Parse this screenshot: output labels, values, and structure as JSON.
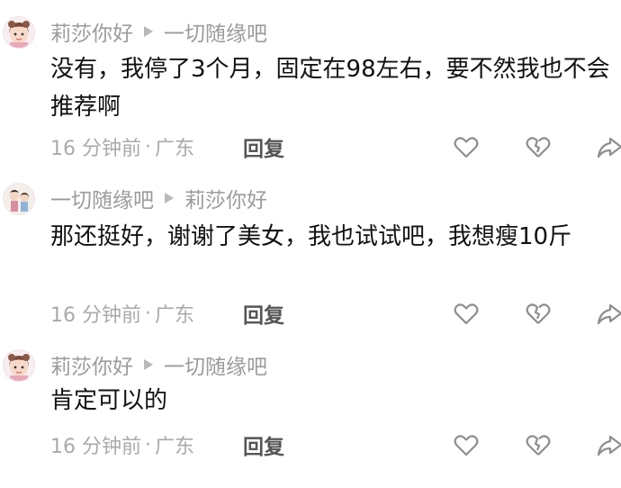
{
  "comments": [
    {
      "author": "莉莎你好",
      "reply_to": "一切随缘吧",
      "text": "没有，我停了3个月，固定在98左右，要不然我也不会推荐啊",
      "time": "16 分钟前",
      "location": "广东",
      "reply_label": "回复",
      "avatar": "girl-avatar-1"
    },
    {
      "author": "一切随缘吧",
      "reply_to": "莉莎你好",
      "text": "那还挺好，谢谢了美女，我也试试吧，我想瘦10斤",
      "time": "16 分钟前",
      "location": "广东",
      "reply_label": "回复",
      "avatar": "girl-avatar-2"
    },
    {
      "author": "莉莎你好",
      "reply_to": "一切随缘吧",
      "text": "肯定可以的",
      "time": "16 分钟前",
      "location": "广东",
      "reply_label": "回复",
      "avatar": "girl-avatar-1"
    }
  ],
  "separator": "·",
  "icons": [
    "heart-icon",
    "broken-heart-icon",
    "share-icon"
  ],
  "colors": {
    "text": "#111111",
    "meta": "#aaaaaa",
    "icon": "#8e8e8e"
  }
}
